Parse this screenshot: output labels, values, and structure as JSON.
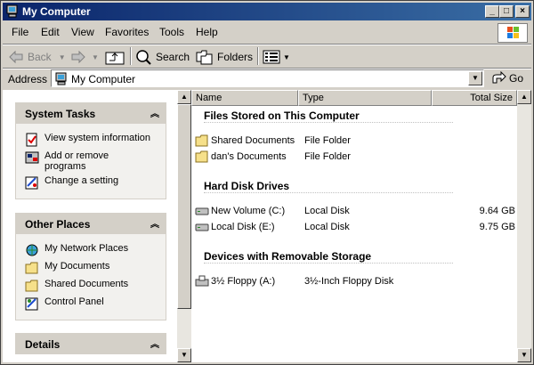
{
  "window": {
    "title": "My Computer"
  },
  "menu": [
    "File",
    "Edit",
    "View",
    "Favorites",
    "Tools",
    "Help"
  ],
  "toolbar": {
    "back": "Back",
    "search": "Search",
    "folders": "Folders"
  },
  "address": {
    "label": "Address",
    "value": "My Computer",
    "go": "Go"
  },
  "panels": {
    "system_tasks": {
      "title": "System Tasks",
      "items": [
        {
          "label": "View system information",
          "icon": "system-info-icon"
        },
        {
          "label": "Add or remove programs",
          "icon": "add-remove-icon"
        },
        {
          "label": "Change a setting",
          "icon": "control-setting-icon"
        }
      ]
    },
    "other_places": {
      "title": "Other Places",
      "items": [
        {
          "label": "My Network Places",
          "icon": "network-places-icon"
        },
        {
          "label": "My Documents",
          "icon": "folder-icon"
        },
        {
          "label": "Shared Documents",
          "icon": "folder-icon"
        },
        {
          "label": "Control Panel",
          "icon": "control-panel-icon"
        }
      ]
    },
    "details": {
      "title": "Details"
    }
  },
  "columns": {
    "name": "Name",
    "type": "Type",
    "size": "Total Size"
  },
  "groups": [
    {
      "title": "Files Stored on This Computer",
      "rows": [
        {
          "name": "Shared Documents",
          "type": "File Folder",
          "size": "",
          "icon": "folder-icon"
        },
        {
          "name": "dan's Documents",
          "type": "File Folder",
          "size": "",
          "icon": "folder-icon"
        }
      ]
    },
    {
      "title": "Hard Disk Drives",
      "rows": [
        {
          "name": "New Volume (C:)",
          "type": "Local Disk",
          "size": "9.64 GB",
          "icon": "hard-disk-icon"
        },
        {
          "name": "Local Disk (E:)",
          "type": "Local Disk",
          "size": "9.75 GB",
          "icon": "hard-disk-icon"
        }
      ]
    },
    {
      "title": "Devices with Removable Storage",
      "rows": [
        {
          "name": "3½ Floppy (A:)",
          "type": "3½-Inch Floppy Disk",
          "size": "",
          "icon": "floppy-drive-icon"
        }
      ]
    }
  ]
}
